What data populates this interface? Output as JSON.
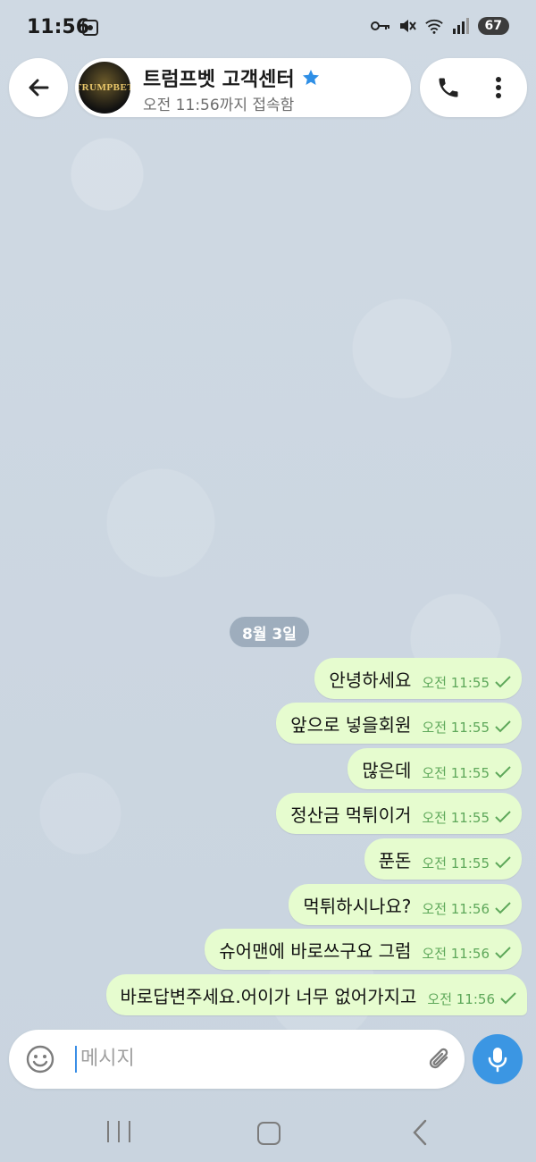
{
  "status_bar": {
    "time": "11:56",
    "battery": "67"
  },
  "header": {
    "title": "트럼프벳 고객센터",
    "subtitle": "오전 11:56까지 접속함",
    "avatar_text": "TRUMPBET"
  },
  "date_separator": "8월 3일",
  "messages": [
    {
      "text": "안녕하세요",
      "time": "오전 11:55"
    },
    {
      "text": "앞으로 넣을회원",
      "time": "오전 11:55"
    },
    {
      "text": "많은데",
      "time": "오전 11:55"
    },
    {
      "text": "정산금 먹튀이거",
      "time": "오전 11:55"
    },
    {
      "text": "푼돈",
      "time": "오전 11:55"
    },
    {
      "text": "먹튀하시나요?",
      "time": "오전 11:56"
    },
    {
      "text": "슈어맨에 바로쓰구요 그럼",
      "time": "오전 11:56"
    },
    {
      "text": "바로답변주세요.어이가 너무 없어가지고",
      "time": "오전 11:56"
    }
  ],
  "input": {
    "placeholder": "메시지"
  },
  "colors": {
    "bubble": "#e6fccf",
    "time_green": "#5ea85a",
    "accent_blue": "#3b96e3",
    "background": "#cbd6e1"
  },
  "icons": [
    "back-arrow-icon",
    "verified-star-icon",
    "phone-icon",
    "more-vertical-icon",
    "emoji-icon",
    "paperclip-icon",
    "microphone-icon",
    "read-check-icon"
  ]
}
